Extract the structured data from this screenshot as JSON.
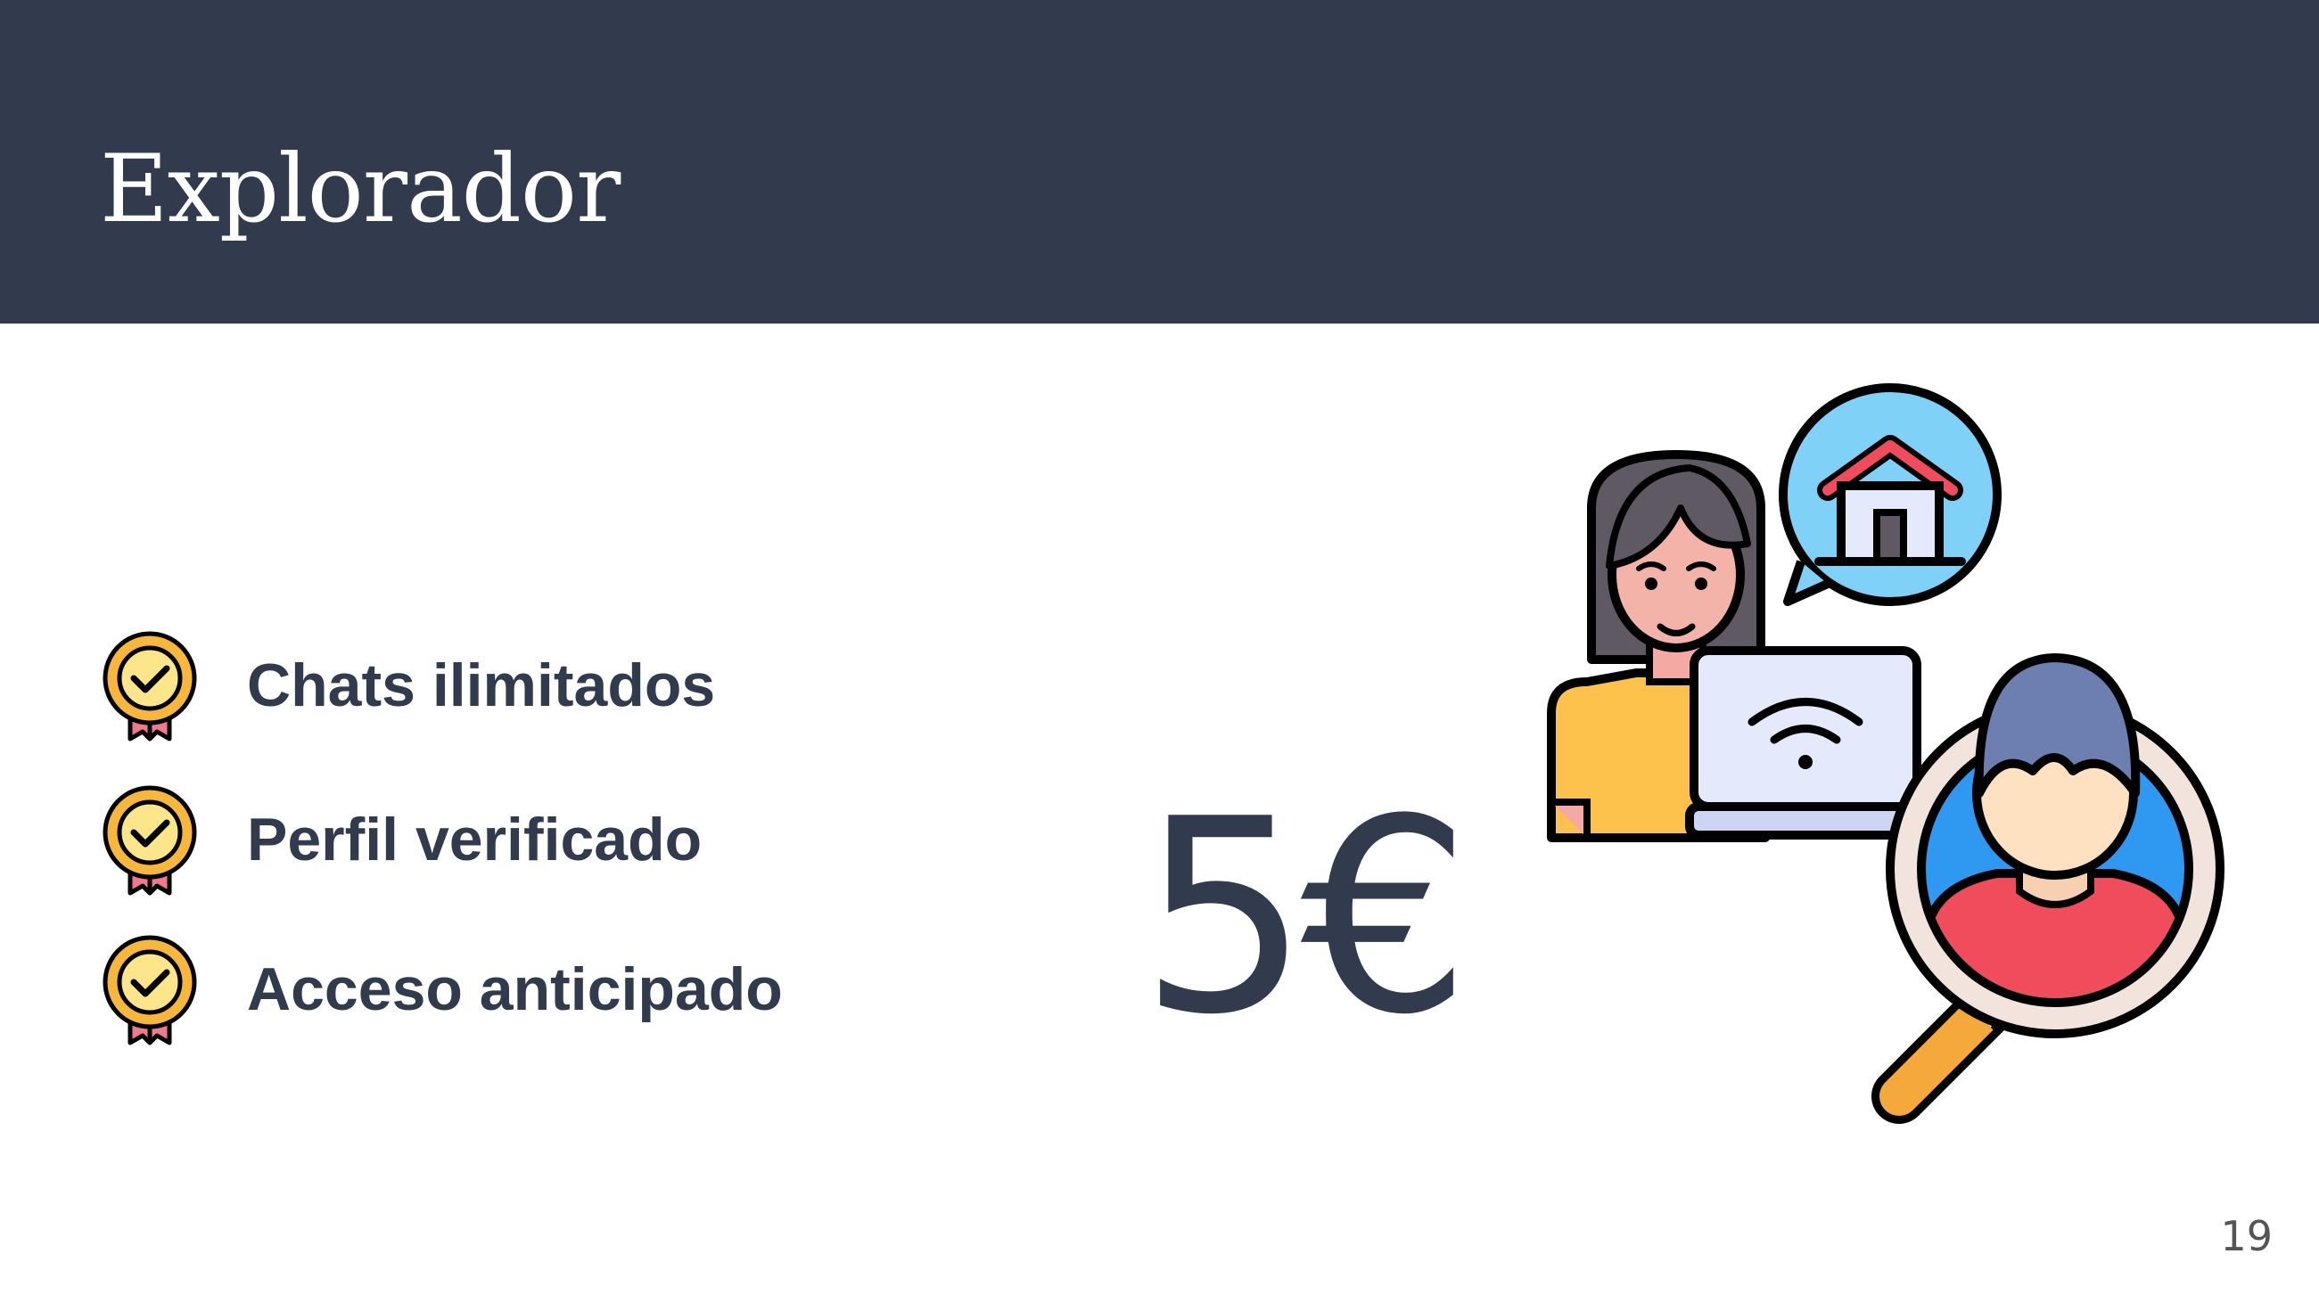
{
  "slide": {
    "title": "Explorador",
    "features": [
      {
        "label": "Chats ilimitados",
        "icon": "medal-check-icon"
      },
      {
        "label": "Perfil verificado",
        "icon": "medal-check-icon"
      },
      {
        "label": "Acceso anticipado",
        "icon": "medal-check-icon"
      }
    ],
    "price": "5€",
    "illustration_icon": "house-search-illustration",
    "page_number": "19"
  },
  "colors": {
    "header_bg": "#323a4d",
    "text_dark": "#323a4d",
    "badge_gold": "#f6b73c",
    "ribbon_pink": "#f07a8c"
  }
}
